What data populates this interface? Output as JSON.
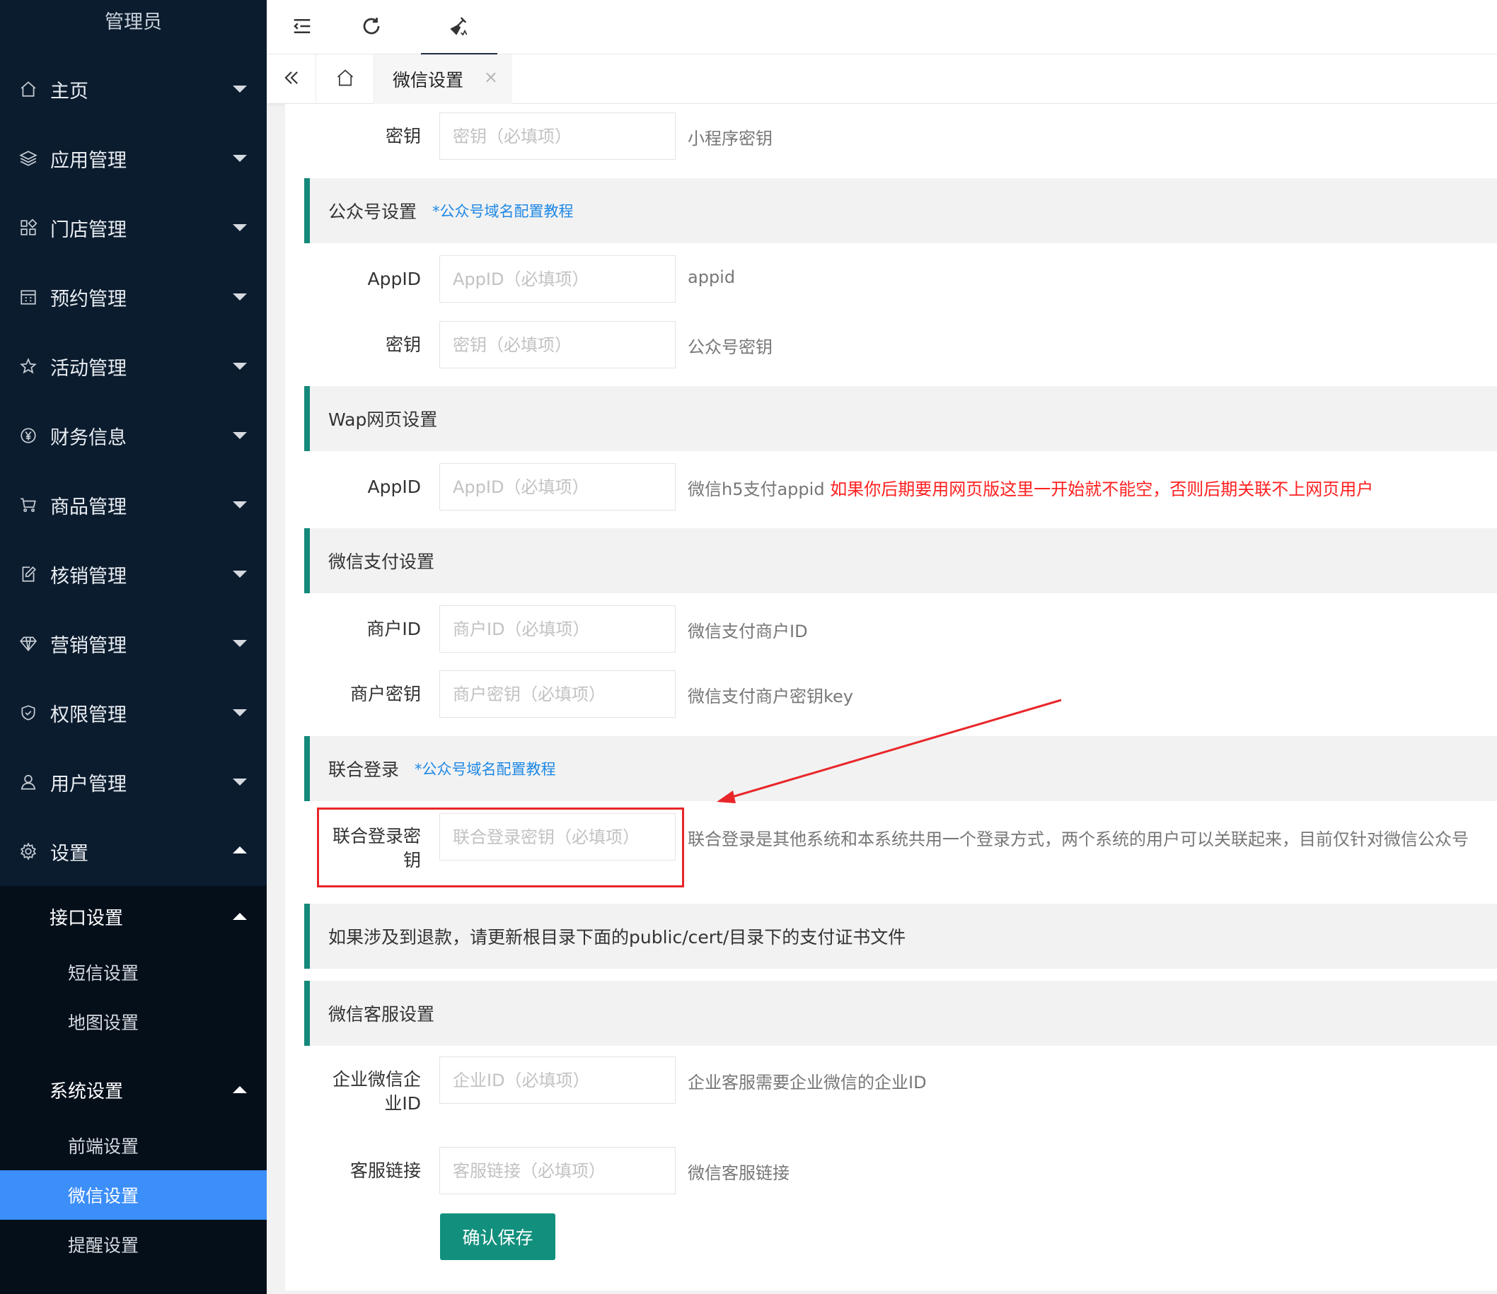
{
  "sidebar": {
    "title": "管理员",
    "items": [
      {
        "label": "主页",
        "icon": "home-icon"
      },
      {
        "label": "应用管理",
        "icon": "layers-icon"
      },
      {
        "label": "门店管理",
        "icon": "apps-icon"
      },
      {
        "label": "预约管理",
        "icon": "calendar-icon"
      },
      {
        "label": "活动管理",
        "icon": "star-icon"
      },
      {
        "label": "财务信息",
        "icon": "yen-icon"
      },
      {
        "label": "商品管理",
        "icon": "cart-icon"
      },
      {
        "label": "核销管理",
        "icon": "edit-icon"
      },
      {
        "label": "营销管理",
        "icon": "diamond-icon"
      },
      {
        "label": "权限管理",
        "icon": "shield-check-icon"
      },
      {
        "label": "用户管理",
        "icon": "user-icon"
      },
      {
        "label": "设置",
        "icon": "gear-icon"
      }
    ],
    "settings_children": {
      "interface": {
        "label": "接口设置",
        "items": [
          "短信设置",
          "地图设置"
        ]
      },
      "system": {
        "label": "系统设置",
        "items": [
          "前端设置",
          "微信设置",
          "提醒设置"
        ],
        "active": "微信设置"
      }
    }
  },
  "topbar": {
    "icons": [
      "menu-fold-icon",
      "refresh-icon",
      "clear-cache-icon"
    ]
  },
  "tabs": {
    "active_label": "微信设置",
    "close_symbol": "×"
  },
  "form": {
    "miniprogram": {
      "secret_label": "密钥",
      "secret_placeholder": "密钥（必填项）",
      "secret_hint": "小程序密钥"
    },
    "mp": {
      "section_title": "公众号设置",
      "section_link": "*公众号域名配置教程",
      "appid_label": "AppID",
      "appid_placeholder": "AppID（必填项）",
      "appid_hint": "appid",
      "secret_label": "密钥",
      "secret_placeholder": "密钥（必填项）",
      "secret_hint": "公众号密钥"
    },
    "wap": {
      "section_title": "Wap网页设置",
      "appid_label": "AppID",
      "appid_placeholder": "AppID（必填项）",
      "appid_hint": "微信h5支付appid",
      "appid_warning": "如果你后期要用网页版这里一开始就不能空，否则后期关联不上网页用户"
    },
    "pay": {
      "section_title": "微信支付设置",
      "mchid_label": "商户ID",
      "mchid_placeholder": "商户ID（必填项）",
      "mchid_hint": "微信支付商户ID",
      "key_label": "商户密钥",
      "key_placeholder": "商户密钥（必填项）",
      "key_hint": "微信支付商户密钥key"
    },
    "union": {
      "section_title": "联合登录",
      "section_link": "*公众号域名配置教程",
      "key_label_line1": "联合登录密",
      "key_label_line2": "钥",
      "key_placeholder": "联合登录密钥（必填项）",
      "key_hint": "联合登录是其他系统和本系统共用一个登录方式，两个系统的用户可以关联起来，目前仅针对微信公众号"
    },
    "refund_notice": "如果涉及到退款，请更新根目录下面的public/cert/目录下的支付证书文件",
    "kefu": {
      "section_title": "微信客服设置",
      "corpid_label_line1": "企业微信企",
      "corpid_label_line2": "业ID",
      "corpid_placeholder": "企业ID（必填项）",
      "corpid_hint": "企业客服需要企业微信的企业ID",
      "link_label": "客服链接",
      "link_placeholder": "客服链接（必填项）",
      "link_hint": "微信客服链接"
    },
    "save_label": "确认保存"
  },
  "colors": {
    "sidebar_bg": "#0b1c2e",
    "active_menu": "#3c8ef8",
    "section_accent": "#14897a",
    "save_button": "#12907d",
    "annotation_red": "#e8262a"
  }
}
